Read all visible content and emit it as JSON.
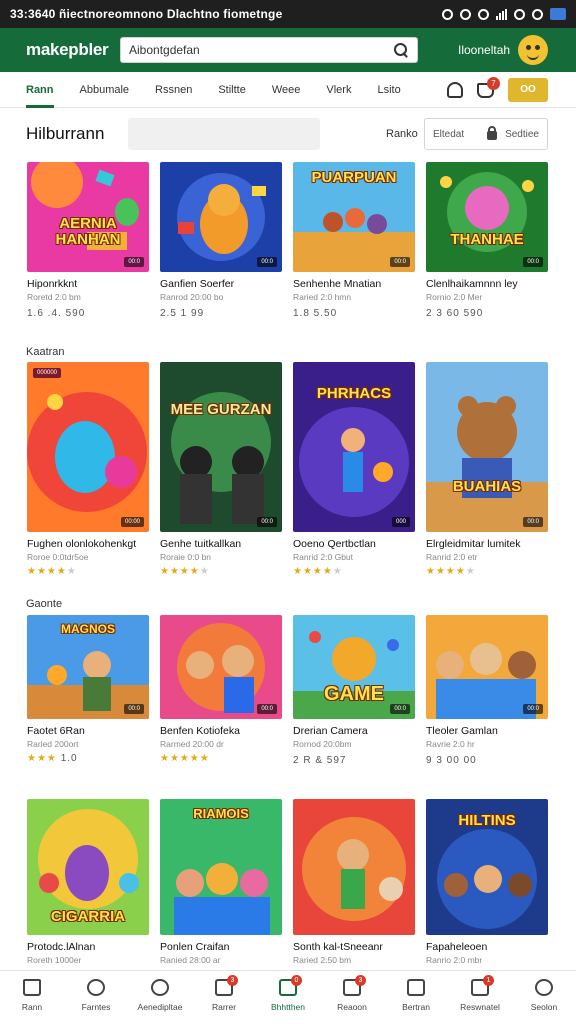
{
  "status_bar": {
    "text": "33:3640 ñiectnoreomnono Dlachtno fiometnge"
  },
  "header": {
    "logo": "makepbler",
    "search_value": "Aibontgdefan",
    "user_name": "Ilooneltah"
  },
  "nav": {
    "tabs": [
      "Rann",
      "Abbumale",
      "Rssnen",
      "Stiltte",
      "Weee",
      "Vlerk",
      "Lsito"
    ],
    "active_tab": 0,
    "cart_badge": "7",
    "button_label": "OO"
  },
  "page": {
    "title": "Hilburrann",
    "sort_label": "Ranko",
    "sort_a": "Eltedat",
    "sort_b": "Sedtiee"
  },
  "sections": [
    {
      "label": "Kaatran"
    },
    {
      "label": "Gaonte"
    }
  ],
  "rows": [
    {
      "cards": [
        {
          "name": "Hiponrkknt",
          "sub": "Roretd 2:0 bm",
          "price": "1.6 .4. 590",
          "art_text": "AERNIA HANHAN",
          "tag": "00:0"
        },
        {
          "name": "Ganfien Soerfer",
          "sub": "Ranrod 20:00 bo",
          "price": "2.5 1 99",
          "art_text": "",
          "tag": "00:0"
        },
        {
          "name": "Senhenhe Mnatian",
          "sub": "Raried 2:0 hmn",
          "price": "1.8 5.50",
          "art_text": "PUARPUAN",
          "tag": "00:0"
        },
        {
          "name": "Clenlhaikamnnn ley",
          "sub": "Rornio 2:0 Mer",
          "price": "2 3 60 590",
          "art_text": "THANHAE",
          "tag": "00:0"
        }
      ]
    },
    {
      "cards": [
        {
          "name": "Fughen olonlokohenkgt",
          "sub": "Roroe 0:0tdr5oe",
          "rating": 4,
          "art_text": "",
          "tag": "00:00",
          "corner": "000000"
        },
        {
          "name": "Genhe tuitkallkan",
          "sub": "Roraie 0:0 bn",
          "rating": 4,
          "art_text": "MEE GURZAN",
          "tag": "00:0"
        },
        {
          "name": "Ooeno Qertbctlan",
          "sub": "Ranrid 2:0 Gbut",
          "rating": 4,
          "art_text": "PHRHACS",
          "tag": "000"
        },
        {
          "name": "Elrgleidmitar lumitek",
          "sub": "Ranrid 2:0 etr",
          "rating": 4,
          "art_text": "BUAHIAS",
          "tag": "00:0"
        }
      ]
    },
    {
      "cards": [
        {
          "name": "Faotet 6Ran",
          "sub": "Raried 200ort",
          "price_stars": 3,
          "price": "1.0",
          "art_text": "MAGNOS",
          "tag": "00:0"
        },
        {
          "name": "Benfen Kotiofeka",
          "sub": "Rarmed 20:00 dr",
          "rating": 5,
          "art_text": "",
          "tag": "00:0"
        },
        {
          "name": "Drerian Camera",
          "sub": "Rornod 20:0bm",
          "price": "2 R & 597",
          "art_text": "GAME",
          "tag": "00:0"
        },
        {
          "name": "Tleoler Gamlan",
          "sub": "Ravrie 2:0 hr",
          "price": "9 3 00 00",
          "art_text": "",
          "tag": "00:0"
        }
      ]
    },
    {
      "cards": [
        {
          "name": "Protodc.lAlnan",
          "sub": "Roreth 1000er",
          "art_text": "CIGARRIA",
          "tag": ""
        },
        {
          "name": "Ponlen Craifan",
          "sub": "Ranied 28:00 ar",
          "art_text": "RIAMOIS",
          "tag": ""
        },
        {
          "name": "Sonth kal-tSneeanr",
          "sub": "Raried 2:50 bm",
          "art_text": "",
          "tag": ""
        },
        {
          "name": "Fapaheleoen",
          "sub": "Ranrio 2:0 mbr",
          "art_text": "HILTINS",
          "tag": ""
        }
      ]
    }
  ],
  "bottom_nav": [
    {
      "label": "Rann",
      "icon": "home-icon",
      "badge": ""
    },
    {
      "label": "Farntes",
      "icon": "info-icon",
      "badge": ""
    },
    {
      "label": "Aenedipltae",
      "icon": "settings-icon",
      "badge": ""
    },
    {
      "label": "Rarrer",
      "icon": "box-icon",
      "badge": "3"
    },
    {
      "label": "Bhhtthen",
      "icon": "bag-icon",
      "badge": "0",
      "active": true
    },
    {
      "label": "Reaoon",
      "icon": "gamepad-icon",
      "badge": "3"
    },
    {
      "label": "Bertran",
      "icon": "chat-icon",
      "badge": ""
    },
    {
      "label": "Reswnatel",
      "icon": "profile-card-icon",
      "badge": "1"
    },
    {
      "label": "Seolon",
      "icon": "menu-icon",
      "badge": ""
    }
  ],
  "colors": {
    "brand": "#156b3a",
    "accent": "#e0b62e",
    "badge": "#d83a2a"
  }
}
